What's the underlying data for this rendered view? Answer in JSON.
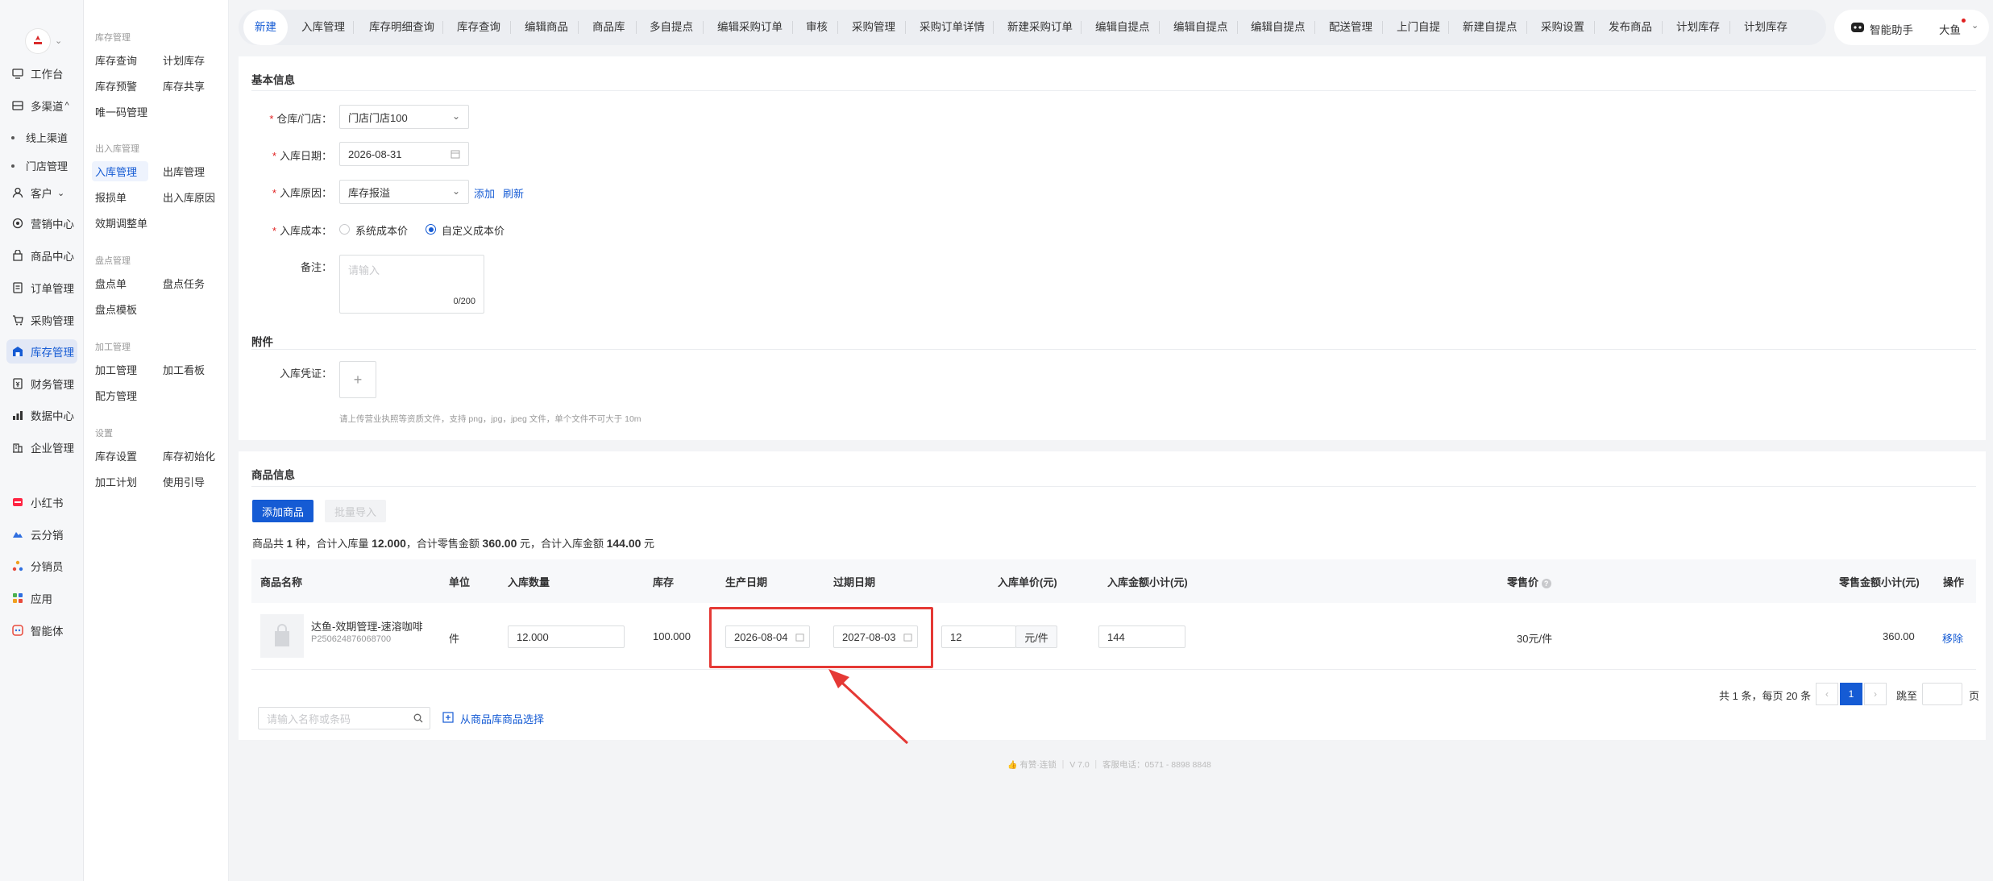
{
  "rail": {
    "logo": "youzan",
    "items": [
      {
        "label": "工作台",
        "icon": "desk-icon"
      },
      {
        "label": "多渠道",
        "icon": "channel-icon",
        "caret": "^"
      },
      {
        "label": "线上渠道",
        "sub": true
      },
      {
        "label": "门店管理",
        "sub": true
      },
      {
        "label": "客户",
        "icon": "user-icon",
        "caret": "⌄"
      },
      {
        "label": "营销中心",
        "icon": "marketing-icon"
      },
      {
        "label": "商品中心",
        "icon": "goods-icon"
      },
      {
        "label": "订单管理",
        "icon": "order-icon"
      },
      {
        "label": "采购管理",
        "icon": "purchase-icon"
      },
      {
        "label": "库存管理",
        "icon": "inventory-icon",
        "active": true
      },
      {
        "label": "财务管理",
        "icon": "finance-icon"
      },
      {
        "label": "数据中心",
        "icon": "data-icon"
      },
      {
        "label": "企业管理",
        "icon": "enterprise-icon"
      },
      {
        "label": "小红书",
        "icon": "xiaohongshu-icon"
      },
      {
        "label": "云分销",
        "icon": "cloud-distribution-icon"
      },
      {
        "label": "分销员",
        "icon": "distributor-icon"
      },
      {
        "label": "应用",
        "icon": "apps-icon"
      },
      {
        "label": "智能体",
        "icon": "agent-icon"
      }
    ]
  },
  "submenu": {
    "groups": [
      {
        "title": "库存管理",
        "items": [
          "库存查询",
          "计划库存",
          "库存预警",
          "库存共享",
          "唯一码管理"
        ]
      },
      {
        "title": "出入库管理",
        "items": [
          "入库管理",
          "出库管理",
          "报损单",
          "出入库原因",
          "效期调整单"
        ]
      },
      {
        "title": "盘点管理",
        "items": [
          "盘点单",
          "盘点任务",
          "盘点模板"
        ]
      },
      {
        "title": "加工管理",
        "items": [
          "加工管理",
          "加工看板",
          "配方管理"
        ]
      },
      {
        "title": "设置",
        "items": [
          "库存设置",
          "库存初始化",
          "加工计划",
          "使用引导"
        ]
      }
    ]
  },
  "tabs": [
    "新建",
    "入库管理",
    "库存明细查询",
    "库存查询",
    "编辑商品",
    "商品库",
    "多自提点",
    "编辑采购订单",
    "审核",
    "采购管理",
    "采购订单详情",
    "新建采购订单",
    "编辑自提点",
    "编辑自提点",
    "编辑自提点",
    "配送管理",
    "上门自提",
    "新建自提点",
    "采购设置",
    "发布商品",
    "计划库存",
    "计划库存"
  ],
  "assistant": {
    "label": "智能助手",
    "user": "大鱼"
  },
  "basic": {
    "title": "基本信息",
    "warehouse_label": "仓库/门店：",
    "warehouse_value": "门店门店100",
    "date_label": "入库日期：",
    "date_value": "2026-08-31",
    "reason_label": "入库原因：",
    "reason_value": "库存报溢",
    "reason_add": "添加",
    "reason_refresh": "刷新",
    "cost_label": "入库成本：",
    "cost_opt1": "系统成本价",
    "cost_opt2": "自定义成本价",
    "cost_selected": 2,
    "remark_label": "备注：",
    "remark_placeholder": "请输入",
    "remark_count": "0/200"
  },
  "attach": {
    "title": "附件",
    "voucher_label": "入库凭证：",
    "plus": "+",
    "hint": "请上传营业执照等资质文件，支持 png，jpg，jpeg 文件，单个文件不可大于 10m"
  },
  "goods": {
    "title": "商品信息",
    "add_btn": "添加商品",
    "import_btn": "批量导入",
    "summary_pre": "商品共 ",
    "kinds": "1",
    "summary_mid1": " 种，合计入库量 ",
    "qty_total": "12.000",
    "summary_mid2": "，合计零售金额 ",
    "retail_total": "360.00",
    "summary_mid3": " 元，合计入库金额 ",
    "in_total": "144.00",
    "summary_end": " 元",
    "headers": [
      "商品名称",
      "单位",
      "入库数量",
      "库存",
      "生产日期",
      "过期日期",
      "入库单价(元)",
      "入库金额小计(元)",
      "零售价",
      "零售金额小计(元)",
      "操作"
    ],
    "row": {
      "name": "达鱼-效期管理-速溶咖啡",
      "code": "P250624876068700",
      "unit": "件",
      "qty": "12.000",
      "stock": "100.000",
      "prod_date": "2026-08-04",
      "exp_date": "2027-08-03",
      "price": "12",
      "price_unit": "元/件",
      "amount": "144",
      "retail": "30元/件",
      "retail_total": "360.00",
      "action": "移除"
    },
    "search_placeholder": "请输入名称或条码",
    "pick_link": "从商品库商品选择",
    "pager": {
      "total": "共 1 条，每页 20 条",
      "prev": "‹",
      "page": "1",
      "next": "›",
      "jump_label": "跳至",
      "page_unit": "页"
    }
  },
  "footer": "有赞·连锁 ｜ V 7.0 ｜ 客服电话：0571 - 8898 8848",
  "colors": {
    "accent": "#155bd4",
    "highlight": "#e53935"
  }
}
